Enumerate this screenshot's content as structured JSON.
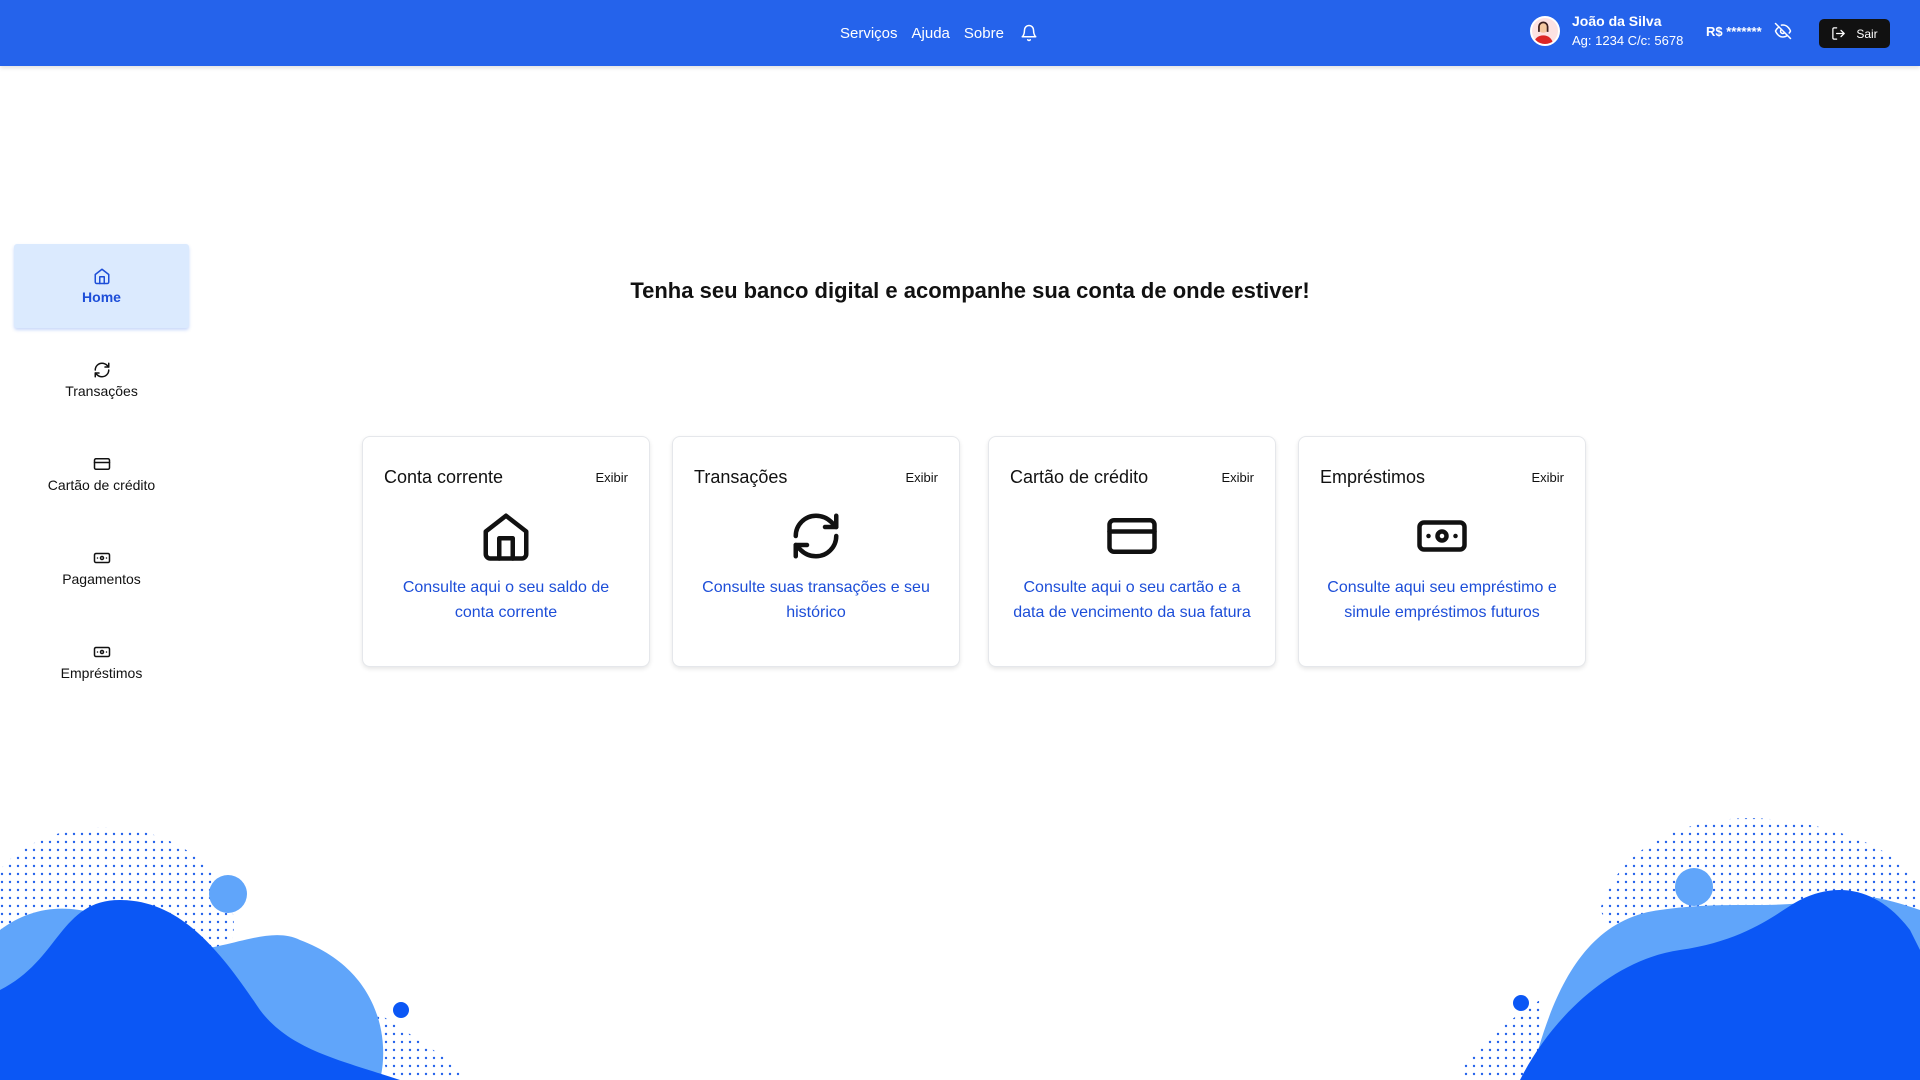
{
  "header": {
    "nav": [
      "Serviços",
      "Ajuda",
      "Sobre"
    ],
    "user_name": "João da Silva",
    "account": "Ag: 1234  C/c: 5678",
    "balance": "R$ *******",
    "logout_label": "Sair"
  },
  "sidebar": {
    "items": [
      {
        "label": "Home",
        "icon": "home-icon"
      },
      {
        "label": "Transações",
        "icon": "refresh-icon"
      },
      {
        "label": "Cartão de crédito",
        "icon": "credit-card-icon"
      },
      {
        "label": "Pagamentos",
        "icon": "banknote-icon"
      },
      {
        "label": "Empréstimos",
        "icon": "banknote-icon"
      }
    ]
  },
  "main": {
    "headline": "Tenha seu banco digital e acompanhe sua conta de onde estiver!",
    "cards": [
      {
        "title": "Conta corrente",
        "button": "Exibir",
        "icon": "home-icon",
        "description": "Consulte aqui o seu saldo de conta corrente"
      },
      {
        "title": "Transações",
        "button": "Exibir",
        "icon": "refresh-icon",
        "description": "Consulte suas transações e seu histórico"
      },
      {
        "title": "Cartão de crédito",
        "button": "Exibir",
        "icon": "credit-card-icon",
        "description": "Consulte aqui o seu cartão e a data de vencimento da sua fatura"
      },
      {
        "title": "Empréstimos",
        "button": "Exibir",
        "icon": "banknote-icon",
        "description": "Consulte aqui seu empréstimo e simule empréstimos futuros"
      }
    ]
  },
  "colors": {
    "primary": "#2563eb",
    "link": "#1d4ed8",
    "active_bg": "#dbeafe",
    "deco_light": "#60a5fa",
    "deco_dark": "#0b57f5"
  }
}
